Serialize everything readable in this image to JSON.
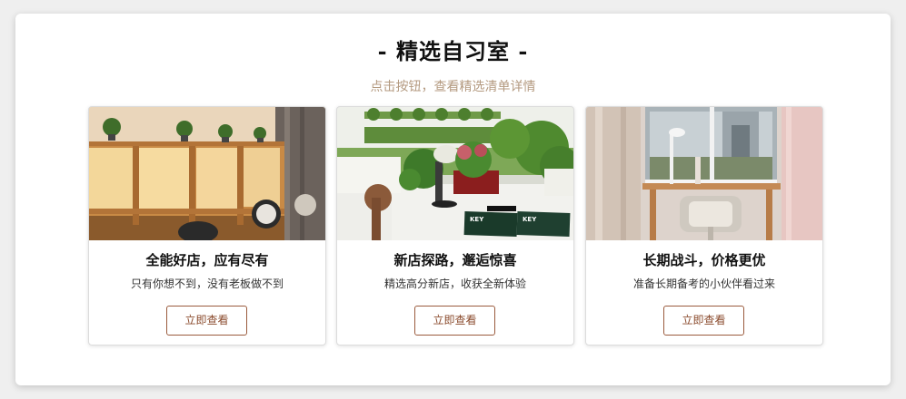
{
  "section": {
    "title": "- 精选自习室 -",
    "subtitle": "点击按钮，查看精选清单详情"
  },
  "cards": [
    {
      "title": "全能好店，应有尽有",
      "description": "只有你想不到，没有老板做不到",
      "button_label": "立即查看"
    },
    {
      "title": "新店探路，邂逅惊喜",
      "description": "精选高分新店，收获全新体验",
      "button_label": "立即查看",
      "book_labels": [
        "KEY",
        "KEY"
      ]
    },
    {
      "title": "长期战斗，价格更优",
      "description": "准备长期备考的小伙伴看过来",
      "button_label": "立即查看"
    }
  ],
  "colors": {
    "accent": "#9a5a3c",
    "subtitle": "#b49a80",
    "background": "#efefef"
  }
}
